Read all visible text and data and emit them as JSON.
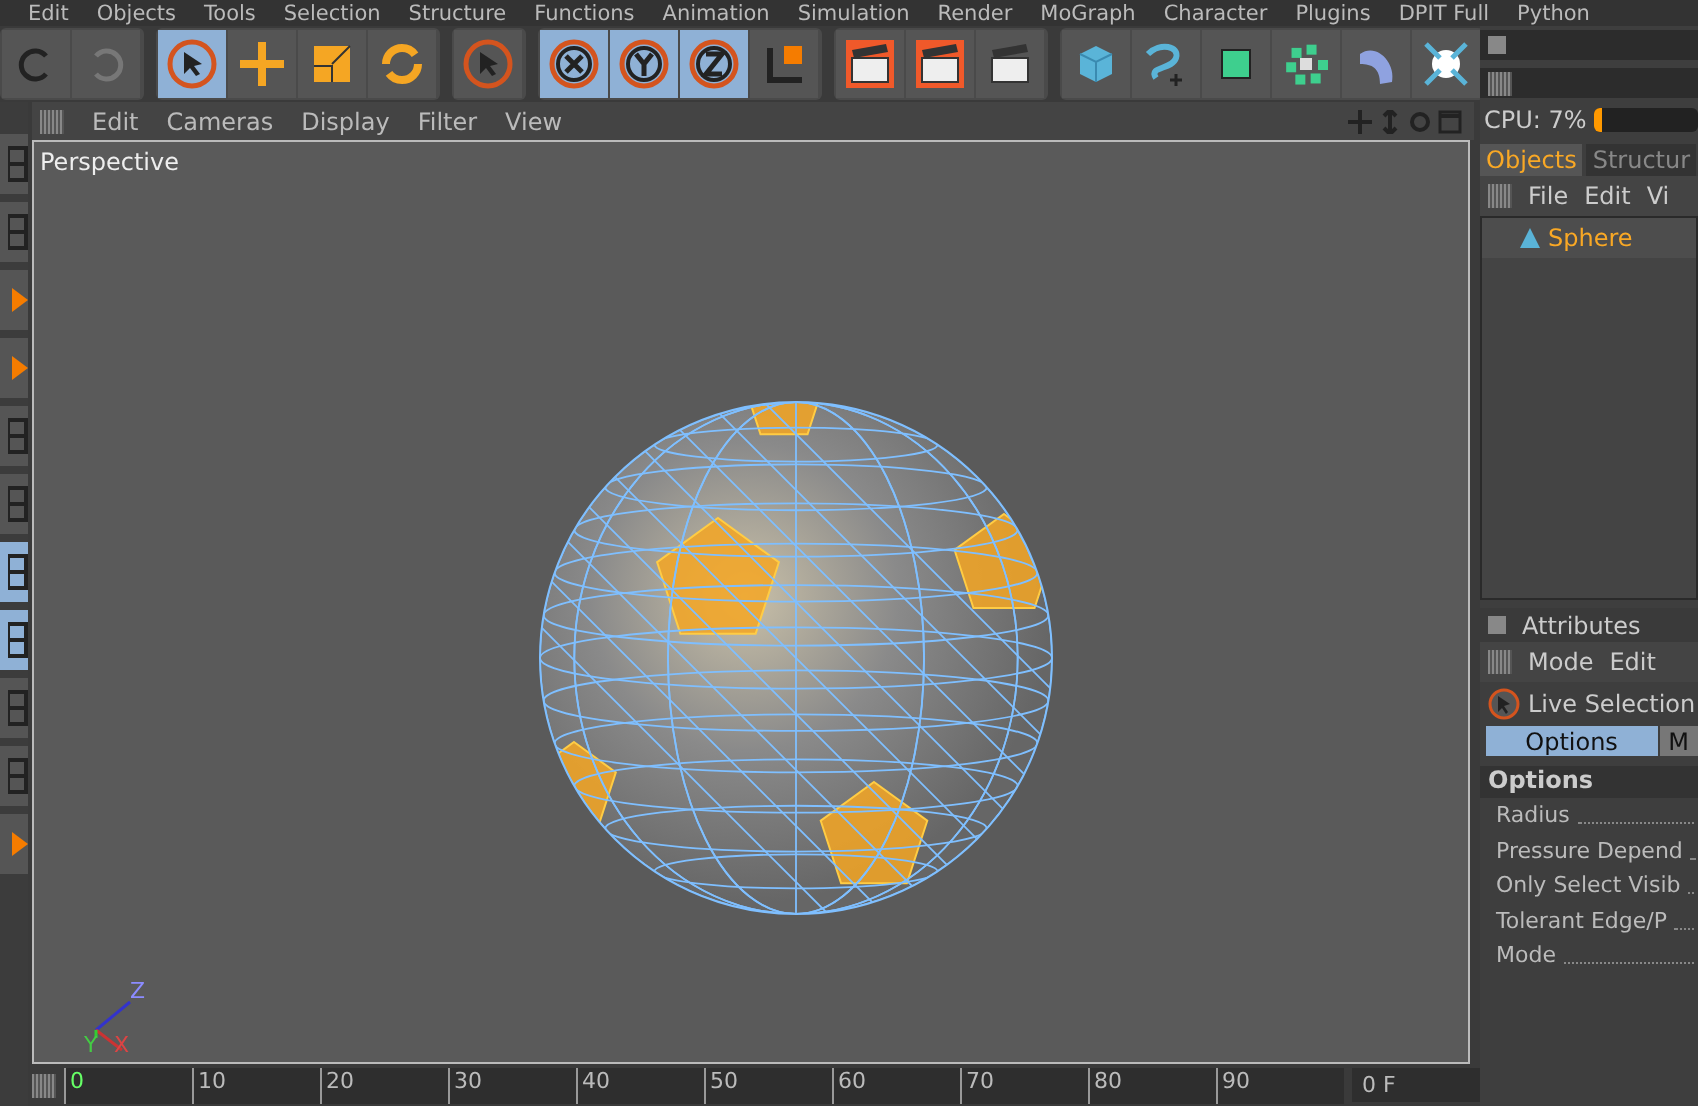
{
  "menu": [
    "Edit",
    "Objects",
    "Tools",
    "Selection",
    "Structure",
    "Functions",
    "Animation",
    "Simulation",
    "Render",
    "MoGraph",
    "Character",
    "Plugins",
    "DPIT Full",
    "Python"
  ],
  "toolbar": [
    [
      {
        "kind": "undo",
        "selected": false
      },
      {
        "kind": "redo",
        "selected": false
      }
    ],
    [
      {
        "kind": "live-select",
        "selected": true
      },
      {
        "kind": "move",
        "selected": false
      },
      {
        "kind": "scale",
        "selected": false
      },
      {
        "kind": "rotate",
        "selected": false
      }
    ],
    [
      {
        "kind": "select",
        "selected": false
      }
    ],
    [
      {
        "kind": "x",
        "selected": true
      },
      {
        "kind": "y",
        "selected": true
      },
      {
        "kind": "z",
        "selected": true
      },
      {
        "kind": "coord",
        "selected": false
      }
    ],
    [
      {
        "kind": "render-view",
        "selected": false
      },
      {
        "kind": "render",
        "selected": false
      },
      {
        "kind": "render-settings",
        "selected": false
      }
    ],
    [
      {
        "kind": "cube",
        "selected": false
      },
      {
        "kind": "spline",
        "selected": false
      },
      {
        "kind": "nurbs",
        "selected": false
      },
      {
        "kind": "array",
        "selected": false
      },
      {
        "kind": "deformer",
        "selected": false
      },
      {
        "kind": "scene",
        "selected": false
      }
    ]
  ],
  "left_toolbar": [
    {
      "kind": "grid",
      "selected": false
    },
    {
      "kind": "grid",
      "selected": false
    },
    {
      "kind": "cone",
      "selected": false
    },
    {
      "kind": "cone",
      "selected": false
    },
    {
      "kind": "grid",
      "selected": false
    },
    {
      "kind": "grid",
      "selected": false
    },
    {
      "kind": "grid",
      "selected": true
    },
    {
      "kind": "grid",
      "selected": true
    },
    {
      "kind": "grid",
      "selected": false
    },
    {
      "kind": "grid",
      "selected": false
    },
    {
      "kind": "cone",
      "selected": false
    }
  ],
  "viewport": {
    "menu": [
      "Edit",
      "Cameras",
      "Display",
      "Filter",
      "View"
    ],
    "label": "Perspective",
    "axes": [
      "Z",
      "Y",
      "X"
    ]
  },
  "cpu": {
    "label": "CPU: 7%",
    "level": 0.07
  },
  "objects": {
    "tabs": [
      {
        "label": "Objects",
        "selected": true
      },
      {
        "label": "Structur",
        "selected": false
      }
    ],
    "menu": [
      "File",
      "Edit",
      "Vi"
    ],
    "items": [
      {
        "name": "Sphere",
        "selected": true
      }
    ]
  },
  "attributes": {
    "title": "Attributes",
    "menu": [
      "Mode",
      "Edit"
    ],
    "tool": "Live Selection",
    "tabs": [
      {
        "label": "Options",
        "selected": true
      },
      {
        "label": "M",
        "selected": false
      }
    ],
    "section": "Options",
    "fields": [
      "Radius",
      "Pressure Depend",
      "Only Select Visib",
      "Tolerant Edge/P",
      "Mode"
    ]
  },
  "timeline": {
    "ticks": [
      "0",
      "10",
      "20",
      "30",
      "40",
      "50",
      "60",
      "70",
      "80",
      "90"
    ],
    "frame": "0 F"
  }
}
